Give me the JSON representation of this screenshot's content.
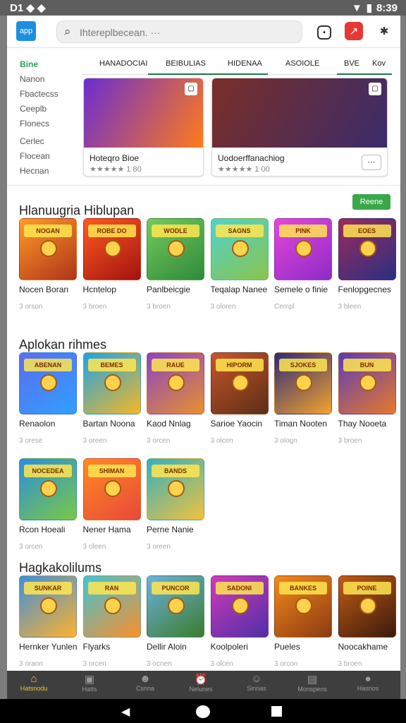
{
  "status": {
    "left": "D1 ◆ ◆",
    "time": "8:39"
  },
  "topbar": {
    "logo": "app",
    "search_placeholder": "Ihtereplbecean. ···"
  },
  "sidebar": [
    "Bine",
    "Nanon",
    "Fbactecss",
    "Ceeplb",
    "Flonecs",
    "Cerlec",
    "Flocean",
    "Hecnan"
  ],
  "tabs": [
    "HANADOCIAI",
    "BEIBULIAS",
    "HIDENAA",
    "ASOIOLE",
    "BVE",
    "Kov"
  ],
  "featured": [
    {
      "title": "Hoteqro Bioe",
      "rating": "★★★★★ 1 80",
      "colors": [
        "#6b2dd0",
        "#ff7b1a"
      ]
    },
    {
      "title": "Uodoerffanachiog",
      "rating": "★★★★★ 1 00",
      "colors": [
        "#7a2f28",
        "#3b2b6b"
      ]
    }
  ],
  "sections": [
    {
      "title": "Hlanuugria Hiblupan",
      "button": "Reene",
      "games": [
        {
          "name": "Nocen Boran",
          "band": "NOGAN",
          "sub": "3 orson",
          "c": [
            "#ff9b28",
            "#b0331a"
          ]
        },
        {
          "name": "Hcntelop",
          "band": "ROBE DO",
          "sub": "3 broen",
          "c": [
            "#ff5a1e",
            "#a21212"
          ]
        },
        {
          "name": "Panlbeicgie",
          "band": "WODLE",
          "sub": "3 broen",
          "c": [
            "#76c95c",
            "#2f8a3b"
          ]
        },
        {
          "name": "Teqalap Nanee",
          "band": "SAGNS",
          "sub": "3 oloren",
          "c": [
            "#4fd3d0",
            "#8bc34a"
          ]
        },
        {
          "name": "Semele o finie",
          "band": "PINK",
          "sub": "Cempl",
          "c": [
            "#e546d8",
            "#8f2bc9"
          ]
        },
        {
          "name": "Fenlopgecnes",
          "band": "EOES",
          "sub": "3 bleen",
          "c": [
            "#9c2b5a",
            "#2b2f83"
          ]
        }
      ]
    },
    {
      "title": "Aplokan rihmes",
      "button": "",
      "games": [
        {
          "name": "Renaolon",
          "band": "ABENAN",
          "sub": "3 orese",
          "c": [
            "#5c6cf0",
            "#2fa0ff"
          ]
        },
        {
          "name": "Bartan Noona",
          "band": "BEMES",
          "sub": "3 oreen",
          "c": [
            "#1ca3e8",
            "#f5b824"
          ]
        },
        {
          "name": "Kaod Nnlag",
          "band": "RAUE",
          "sub": "3 orcen",
          "c": [
            "#8a43c8",
            "#e9912b"
          ]
        },
        {
          "name": "Sarioe Yaocin",
          "band": "HIPORM",
          "sub": "3 olcen",
          "c": [
            "#c9542c",
            "#5b2f15"
          ]
        },
        {
          "name": "Timan Nooten",
          "band": "SJOKES",
          "sub": "3 ologn",
          "c": [
            "#2f2a7a",
            "#f2a32c"
          ]
        },
        {
          "name": "Thay Nooeta",
          "band": "BUN",
          "sub": "3 broen",
          "c": [
            "#5c3bb8",
            "#e67a2b"
          ]
        },
        {
          "name": "Rcon Hoeali",
          "band": "NOCEDEA",
          "sub": "3 orcen",
          "c": [
            "#2b8de0",
            "#7ac943"
          ]
        },
        {
          "name": "Nener Hama",
          "band": "SHIMAN",
          "sub": "3 oleen",
          "c": [
            "#ff8a22",
            "#e8483a"
          ]
        },
        {
          "name": "Perne Nanie",
          "band": "BANDS",
          "sub": "3 oreen",
          "c": [
            "#31b0c4",
            "#f2c23a"
          ]
        }
      ]
    },
    {
      "title": "Hagkakolilums",
      "button": "",
      "games": [
        {
          "name": "Hernker Yunlen",
          "band": "SUNKAR",
          "sub": "3 oraon",
          "c": [
            "#3d8fe0",
            "#ffb22a"
          ]
        },
        {
          "name": "Flyarks",
          "band": "RAN",
          "sub": "3 orcen",
          "c": [
            "#3ec4d8",
            "#ff8e2a"
          ]
        },
        {
          "name": "Dellir Aloin",
          "band": "PUNCOR",
          "sub": "3 ocnen",
          "c": [
            "#6cb1e0",
            "#3c7c2b"
          ]
        },
        {
          "name": "Koolpoleri",
          "band": "SADONI",
          "sub": "3 olcen",
          "c": [
            "#d23ab8",
            "#4f2fa7"
          ]
        },
        {
          "name": "Pueles",
          "band": "BANKES",
          "sub": "3 orcon",
          "c": [
            "#f28a1b",
            "#8c3a12"
          ]
        },
        {
          "name": "Noocakhame",
          "band": "POINE",
          "sub": "3 broen",
          "c": [
            "#c25a17",
            "#3b1b0b"
          ]
        }
      ]
    }
  ],
  "bottom_nav": [
    "Hatsnodu",
    "Hatts",
    "Csnna",
    "Nelunes",
    "Sinnas",
    "Monspens",
    "Hasnos"
  ]
}
